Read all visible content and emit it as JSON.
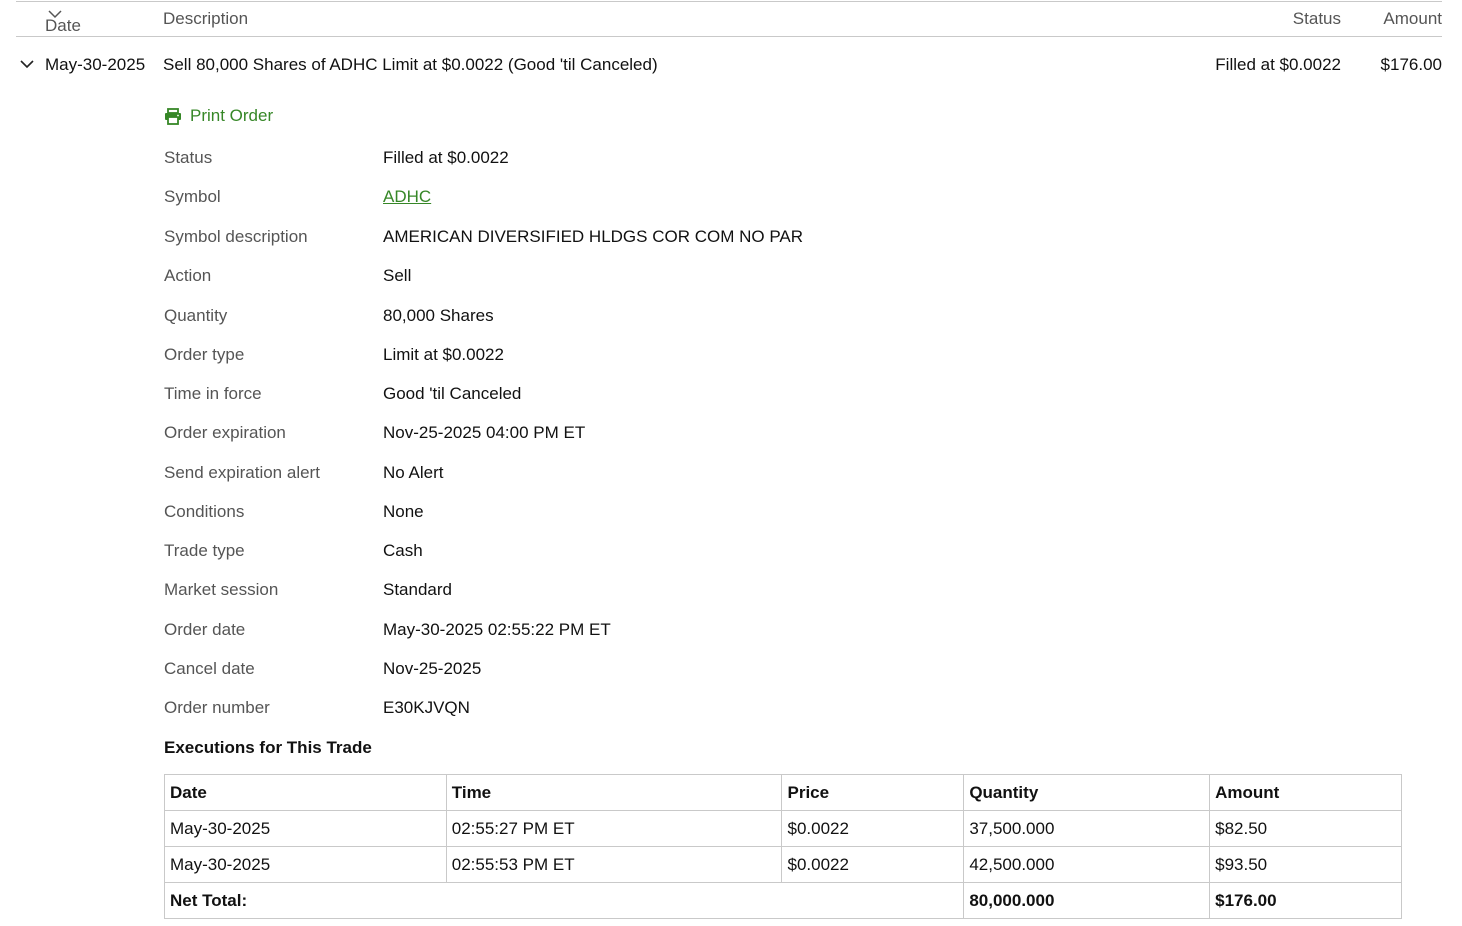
{
  "header": {
    "date": "Date",
    "description": "Description",
    "status": "Status",
    "amount": "Amount"
  },
  "order": {
    "date": "May-30-2025",
    "description": "Sell 80,000 Shares of ADHC Limit at $0.0022 (Good 'til Canceled)",
    "status": "Filled at $0.0022",
    "amount": "$176.00"
  },
  "print_label": "Print Order",
  "details": [
    {
      "label": "Status",
      "value": "Filled at $0.0022"
    },
    {
      "label": "Symbol",
      "value": "ADHC"
    },
    {
      "label": "Symbol description",
      "value": "AMERICAN DIVERSIFIED HLDGS COR COM NO PAR"
    },
    {
      "label": "Action",
      "value": "Sell"
    },
    {
      "label": "Quantity",
      "value": "80,000 Shares"
    },
    {
      "label": "Order type",
      "value": "Limit at $0.0022"
    },
    {
      "label": "Time in force",
      "value": "Good 'til Canceled"
    },
    {
      "label": "Order expiration",
      "value": "Nov-25-2025 04:00 PM ET"
    },
    {
      "label": "Send expiration alert",
      "value": "No Alert"
    },
    {
      "label": "Conditions",
      "value": "None"
    },
    {
      "label": "Trade type",
      "value": "Cash"
    },
    {
      "label": "Market session",
      "value": "Standard"
    },
    {
      "label": "Order date",
      "value": "May-30-2025 02:55:22 PM ET"
    },
    {
      "label": "Cancel date",
      "value": "Nov-25-2025"
    },
    {
      "label": "Order number",
      "value": "E30KJVQN"
    }
  ],
  "executions": {
    "title": "Executions for This Trade",
    "columns": [
      "Date",
      "Time",
      "Price",
      "Quantity",
      "Amount"
    ],
    "rows": [
      [
        "May-30-2025",
        "02:55:27 PM ET",
        "$0.0022",
        "37,500.000",
        "$82.50"
      ],
      [
        "May-30-2025",
        "02:55:53 PM ET",
        "$0.0022",
        "42,500.000",
        "$93.50"
      ]
    ],
    "net_total_label": "Net Total:",
    "net_total_quantity": "80,000.000",
    "net_total_amount": "$176.00"
  },
  "colors": {
    "accent": "#368727",
    "label_gray": "#555555",
    "border": "#c9c9c9"
  },
  "icons": {
    "sort": "chevron-down-icon",
    "expand": "chevron-down-icon",
    "print": "printer-icon"
  }
}
